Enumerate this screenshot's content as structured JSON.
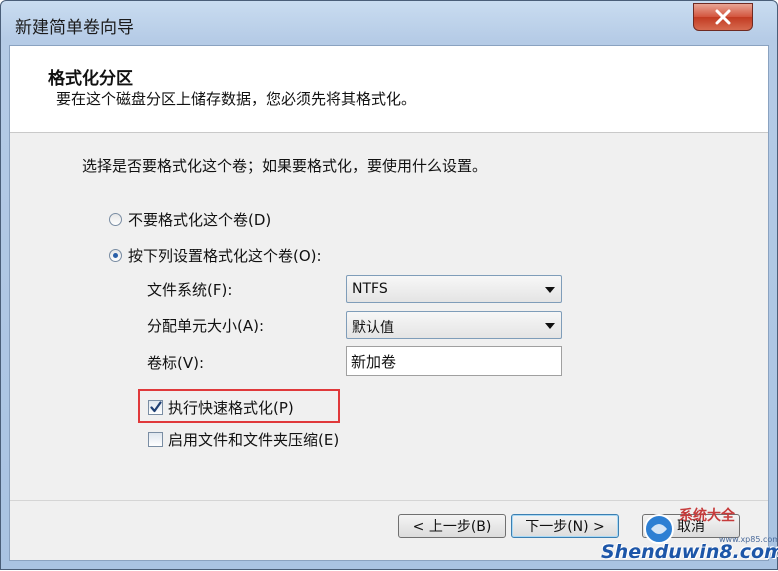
{
  "window": {
    "title": "新建简单卷向导"
  },
  "header": {
    "title": "格式化分区",
    "subtitle": "要在这个磁盘分区上储存数据，您必须先将其格式化。"
  },
  "prompt": "选择是否要格式化这个卷；如果要格式化，要使用什么设置。",
  "options": {
    "no_format": {
      "label": "不要格式化这个卷(D)",
      "selected": false
    },
    "format": {
      "label": "按下列设置格式化这个卷(O):",
      "selected": true
    }
  },
  "fields": {
    "file_system": {
      "label": "文件系统(F):",
      "value": "NTFS"
    },
    "allocation_unit": {
      "label": "分配单元大小(A):",
      "value": "默认值"
    },
    "volume_label": {
      "label": "卷标(V):",
      "value": "新加卷"
    }
  },
  "checkboxes": {
    "quick_format": {
      "label": "执行快速格式化(P)",
      "checked": true
    },
    "compression": {
      "label": "启用文件和文件夹压缩(E)",
      "checked": false
    }
  },
  "buttons": {
    "back": "< 上一步(B)",
    "next": "下一步(N) >",
    "cancel": "取消"
  },
  "watermark": {
    "brand": "Shenduwin8.com",
    "tag": "系统大全",
    "url": "www.xp85.com"
  },
  "colors": {
    "highlight": "#e0393b",
    "close_button": "#c23b22",
    "title_bar": "#b5cbe6"
  }
}
